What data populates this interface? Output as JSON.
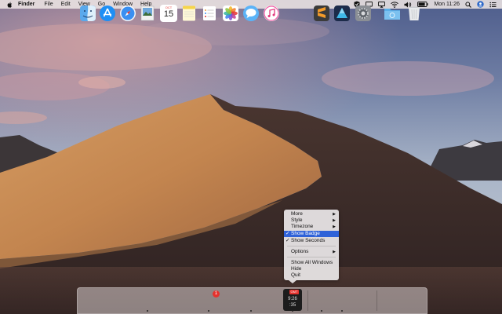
{
  "colors": {
    "menu_highlight": "#2f62d8",
    "badge_red": "#e5322d"
  },
  "menubar": {
    "apple_icon": "apple-icon",
    "items": [
      "Finder",
      "File",
      "Edit",
      "View",
      "Go",
      "Window",
      "Help"
    ],
    "status": {
      "icons": [
        "shield-icon",
        "display-icon",
        "airplay-icon",
        "wifi-icon",
        "volume-icon",
        "battery-icon"
      ],
      "clock": "Mon 11:26",
      "extra_icons": [
        "search-icon",
        "user-icon",
        "list-icon"
      ]
    }
  },
  "context_menu": {
    "items": [
      {
        "label": "More",
        "submenu": true
      },
      {
        "label": "Style",
        "submenu": true
      },
      {
        "label": "Timezone",
        "submenu": true
      },
      {
        "label": "Show Badge",
        "checked": true,
        "selected": true
      },
      {
        "label": "Show Seconds",
        "checked": true
      },
      {
        "label": "Options",
        "submenu": true
      },
      {
        "label": "Show All Windows"
      },
      {
        "label": "Hide"
      },
      {
        "label": "Quit"
      }
    ],
    "check_glyph": "✓",
    "arrow_glyph": "▶"
  },
  "dock": {
    "apps": [
      "Finder",
      "App Store",
      "Safari",
      "Preview",
      "Calendar",
      "Notes",
      "Reminders",
      "Photos",
      "Messages",
      "iTunes",
      "Clock",
      "Sublime Text",
      "Affinity Designer",
      "System Preferences"
    ],
    "calendar": {
      "month": "OCT",
      "day": "15"
    },
    "reminders_badge": "1",
    "clock_widget": {
      "badge": "GMT",
      "time": "9:26",
      "seconds": ":35"
    },
    "folders": [
      "Downloads",
      "Trash"
    ]
  }
}
